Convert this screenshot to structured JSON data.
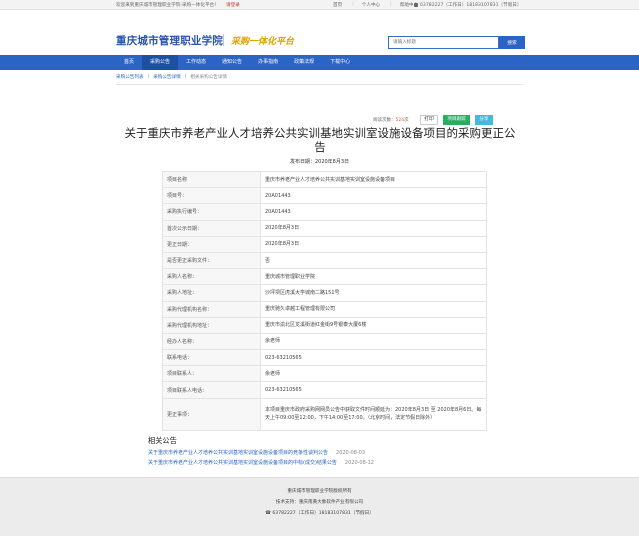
{
  "topbar": {
    "welcome": "欢迎来到重庆城市管理职业学院-采购一体化平台！",
    "login": "请登录",
    "links": [
      "首页",
      "个人中心",
      "帮助中心"
    ],
    "hotline": "63782227（工作日）18183107831（节假日）"
  },
  "header": {
    "school_name": "重庆城市管理职业学院",
    "platform_name": "采购一体化平台",
    "search_placeholder": "请输入标题",
    "search_button": "搜索"
  },
  "nav": {
    "items": [
      "首页",
      "采购公告",
      "工作动态",
      "通知公告",
      "办事指南",
      "政策法规",
      "下载中心"
    ],
    "active": "采购公告"
  },
  "breadcrumb": [
    "采购公告列表",
    "采购公告详情",
    "相关采购公告详情"
  ],
  "actions": {
    "views_label": "阅读次数：",
    "views_count": "524",
    "views_unit": "次",
    "print": "打印",
    "project_detail": "项目跟踪",
    "share": "分享"
  },
  "notice": {
    "title": "关于重庆市养老产业人才培养公共实训基地实训室设施设备项目的采购更正公告",
    "published": "发布日期：2020年8月3日"
  },
  "info_rows": [
    {
      "key": "项目名称",
      "value": "重庆市养老产业人才培养公共实训基地实训室设施设备项目"
    },
    {
      "key": "项目号：",
      "value": "20A01443"
    },
    {
      "key": "采购执行编号：",
      "value": "20A01443"
    },
    {
      "key": "首次公示日期：",
      "value": "2020年8月3日"
    },
    {
      "key": "更正日期：",
      "value": "2020年8月3日"
    },
    {
      "key": "是否更正采购文件：",
      "value": "否"
    },
    {
      "key": "采购人名称：",
      "value": "重庆城市管理职业学院"
    },
    {
      "key": "采购人地址：",
      "value": "沙坪坝区虎溪大学城南二路151号"
    },
    {
      "key": "采购代理机构名称：",
      "value": "重庆驰久卓越工程管理有限公司"
    },
    {
      "key": "采购代理机构地址：",
      "value": "重庆市渝北区龙溪街道红金街9号银泰大厦6楼"
    },
    {
      "key": "经办人名称：",
      "value": "余老师"
    },
    {
      "key": "联系电话：",
      "value": "023-63210565"
    },
    {
      "key": "项目联系人：",
      "value": "余老师"
    },
    {
      "key": "项目联系人电话：",
      "value": "023-63210565"
    },
    {
      "key": "更正事项：",
      "value": "本项目重庆市政府采购网网员公告中获取文件时间顺延为：2020年8月3日 至 2020年8月6日。每天上午09:00至12:00，下午14:00至17:00。（北京时间，法定节假日除外）"
    }
  ],
  "related": {
    "title": "相关公告",
    "items": [
      {
        "title": "关于重庆市养老产业人才培养公共实训基地实训室设施设备项目的竞争性谈判公告",
        "date": "2020-08-03"
      },
      {
        "title": "关于重庆市养老产业人才培养公共实训基地实训室设施设备项目的中标(成交)结果公告",
        "date": "2020-08-12"
      }
    ]
  },
  "footer": {
    "copyright": "重庆城市管理职业学院版权所有",
    "support": "技术支持：重庆南黄大象软件产业有限公司",
    "phones": "63782227（工作日）18183107831（节假日）"
  }
}
